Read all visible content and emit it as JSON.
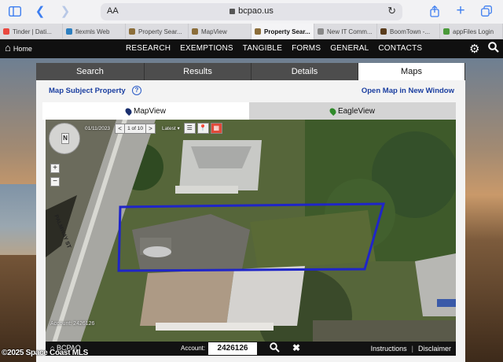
{
  "browser": {
    "url": "bcpao.us",
    "text_size_label": "AA",
    "tabs": [
      {
        "label": "Tinder | Dati...",
        "favicon_color": "#e9483f"
      },
      {
        "label": "flexmls Web",
        "favicon_color": "#2d7fc0"
      },
      {
        "label": "Property Sear...",
        "favicon_color": "#8c6e3a"
      },
      {
        "label": "MapView",
        "favicon_color": "#8c6e3a"
      },
      {
        "label": "Property Sear...",
        "favicon_color": "#8c6e3a",
        "active": true
      },
      {
        "label": "New IT Comm...",
        "favicon_color": "#888888"
      },
      {
        "label": "BoomTown -...",
        "favicon_color": "#5a3c1c"
      },
      {
        "label": "appFiles Login",
        "favicon_color": "#4a9a3a"
      }
    ]
  },
  "site_nav": {
    "home_label": "Home",
    "items": [
      "RESEARCH",
      "EXEMPTIONS",
      "TANGIBLE",
      "FORMS",
      "GENERAL",
      "CONTACTS"
    ]
  },
  "main_tabs": [
    {
      "label": "Search"
    },
    {
      "label": "Results"
    },
    {
      "label": "Details"
    },
    {
      "label": "Maps",
      "active": true
    }
  ],
  "maps": {
    "subject_link": "Map Subject Property",
    "help_icon": "?",
    "open_new_window": "Open Map in New Window",
    "view_tabs": [
      {
        "label": "MapView",
        "active": true,
        "pin_color": "#1a2f6e"
      },
      {
        "label": "EagleView",
        "active": false,
        "pin_color": "#2f8a2a"
      }
    ],
    "toolbar": {
      "date": "01/11/2023",
      "prev": "<",
      "page": "1 of 10",
      "next": ">",
      "latest": "Latest ▾"
    },
    "compass_label": "N",
    "zoom_in": "+",
    "zoom_out": "−",
    "street_label": "PALMWAY ST",
    "account_overlay": "Account: 2426126",
    "bottom_bar": {
      "logo": "BCPAO",
      "account_label": "Account:",
      "account_value": "2426126",
      "clear": "✖",
      "instructions": "Instructions",
      "separator": "|",
      "disclaimer": "Disclaimer"
    }
  },
  "watermark": "©2025 Space Coast MLS",
  "colors": {
    "link": "#1a3ea0",
    "parcel_outline": "#1f25c8",
    "nav_bg": "#101010",
    "tab_inactive": "#4d4d4d"
  }
}
